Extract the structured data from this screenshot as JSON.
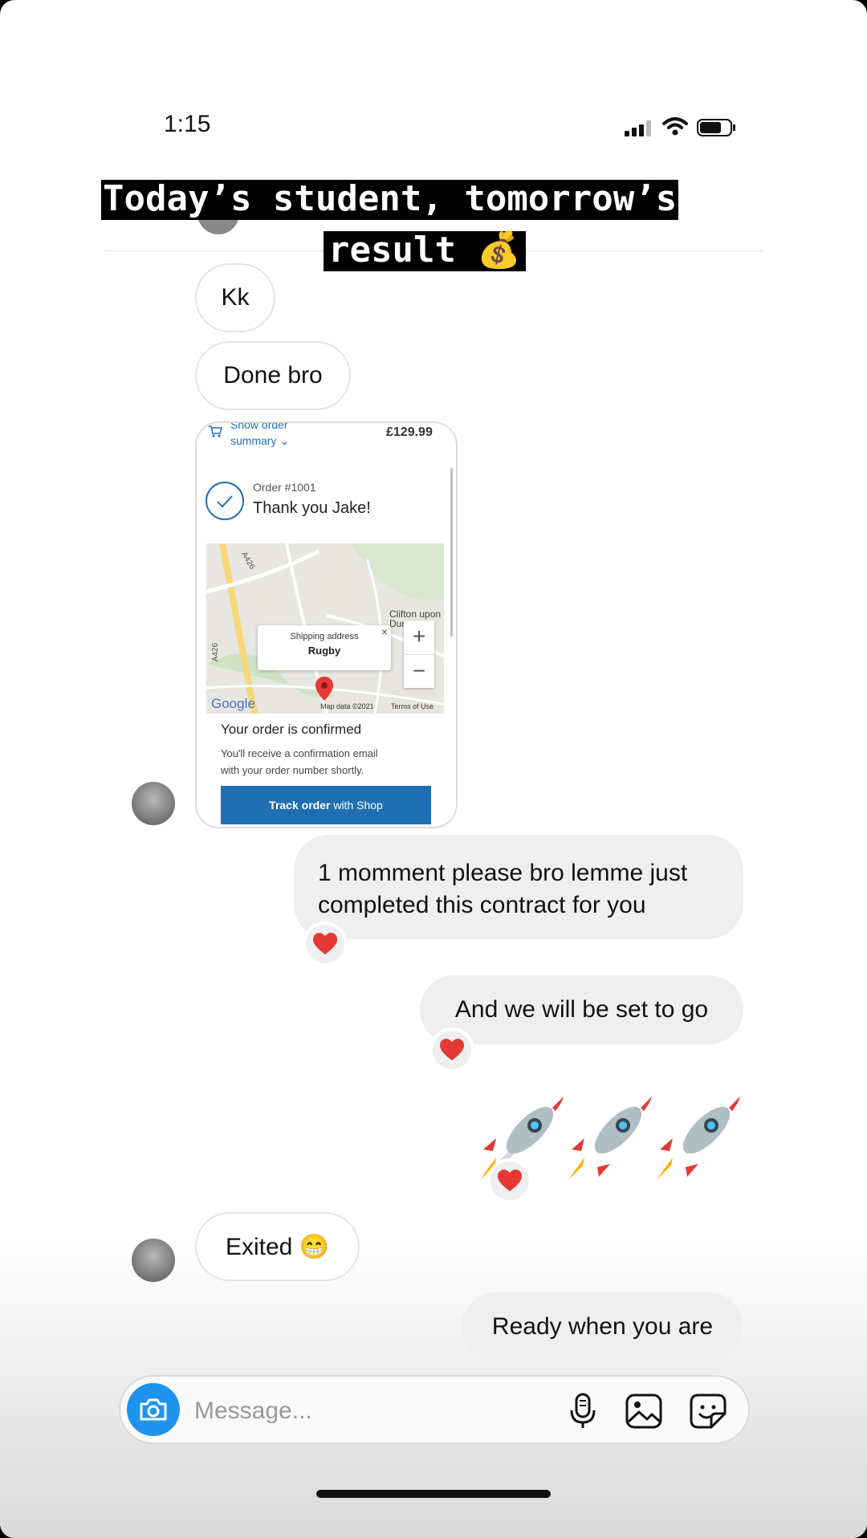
{
  "status_bar": {
    "time": "1:15"
  },
  "caption": {
    "line1": "Today’s student, tomorrow’s",
    "line2": "result 💰"
  },
  "messages": {
    "kk": "Kk",
    "done": "Done bro",
    "moment_line1": "1 momment please bro lemme just",
    "moment_line2": "completed this contract for you",
    "set_to_go": "And we will be set to go",
    "exited": "Exited 😁",
    "ready": "Ready when you are"
  },
  "order_screenshot": {
    "summary_line1": "Show order",
    "summary_line2": "summary",
    "price": "£129.99",
    "order_number": "Order #1001",
    "thank_you": "Thank you Jake!",
    "map_place": "Clifton upon Dunsmore",
    "road_1": "A426",
    "road_2": "A426",
    "popup_title": "Shipping address",
    "popup_value": "Rugby",
    "map_brand": "Google",
    "map_data": "Map data ©2021",
    "map_terms": "Terms of Use",
    "confirmed_title": "Your order is confirmed",
    "confirmed_text_1": "You'll receive a confirmation email",
    "confirmed_text_2": "with your order number shortly.",
    "track_label": "Track order",
    "track_suffix": " with Shop"
  },
  "composer": {
    "placeholder": "Message..."
  },
  "colors": {
    "reaction_heart": "#e53935",
    "camera_button": "#1f94ee",
    "track_button": "#1f6fb2"
  },
  "icons": [
    "camera-icon",
    "microphone-icon",
    "gallery-icon",
    "sticker-icon",
    "heart-icon",
    "rocket-icon"
  ]
}
